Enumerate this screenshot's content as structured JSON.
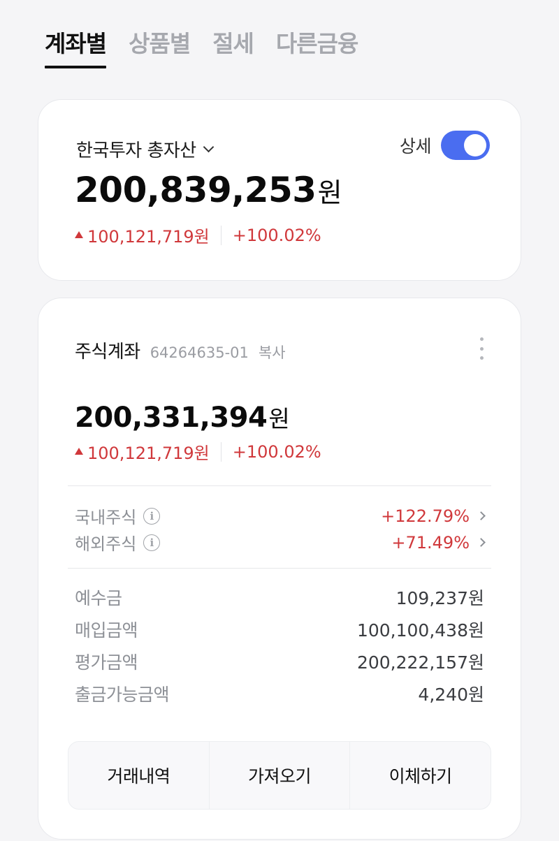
{
  "tabs": [
    {
      "label": "계좌별",
      "active": true
    },
    {
      "label": "상품별",
      "active": false
    },
    {
      "label": "절세",
      "active": false
    },
    {
      "label": "다른금융",
      "active": false
    }
  ],
  "summary": {
    "label": "한국투자 총자산",
    "detail_label": "상세",
    "detail_toggle_on": true,
    "amount": "200,839,253",
    "unit": "원",
    "change_amount": "100,121,719원",
    "change_pct": "+100.02%"
  },
  "account": {
    "name": "주식계좌",
    "number": "64264635-01",
    "copy_label": "복사",
    "amount": "200,331,394",
    "unit": "원",
    "change_amount": "100,121,719원",
    "change_pct": "+100.02%",
    "stocks": [
      {
        "name": "국내주식",
        "pct": "+122.79%"
      },
      {
        "name": "해외주식",
        "pct": "+71.49%"
      }
    ],
    "details": [
      {
        "label": "예수금",
        "value": "109,237원"
      },
      {
        "label": "매입금액",
        "value": "100,100,438원"
      },
      {
        "label": "평가금액",
        "value": "200,222,157원"
      },
      {
        "label": "출금가능금액",
        "value": "4,240원"
      }
    ],
    "actions": [
      "거래내역",
      "가져오기",
      "이체하기"
    ]
  },
  "colors": {
    "accent": "#4a6df0",
    "up": "#d0383b",
    "muted": "#8d9096"
  },
  "icons": {
    "dropdown": "chevron-down-icon",
    "more": "more-vertical-icon",
    "info": "info-icon",
    "row_arrow": "chevron-right-icon",
    "up": "triangle-up-icon"
  }
}
